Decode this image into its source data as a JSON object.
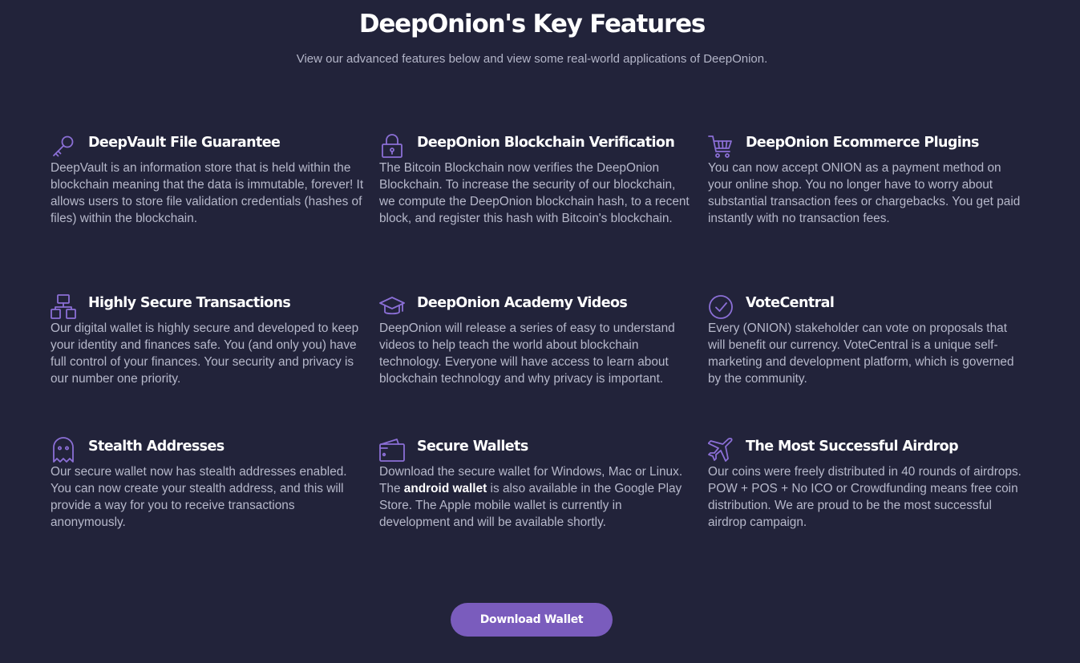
{
  "header": {
    "title": "DeepOnion's Key Features",
    "subtitle": "View our advanced features below and view some real-world applications of DeepOnion."
  },
  "colors": {
    "background": "#22233a",
    "accent": "#7a5cbd",
    "icon": "#8b6fd6",
    "heading": "#ffffff",
    "text": "#b6b8ca"
  },
  "features": [
    {
      "icon": "key-icon",
      "title": "DeepVault File Guarantee",
      "description": "DeepVault is an information store that is held within the blockchain meaning that the data is immutable, forever! It allows users to store file validation credentials (hashes of files) within the blockchain."
    },
    {
      "icon": "padlock-icon",
      "title": "DeepOnion Blockchain Verification",
      "description": "The Bitcoin Blockchain now verifies the DeepOnion Blockchain. To increase the security of our blockchain, we compute the DeepOnion blockchain hash, to a recent block, and register this hash with Bitcoin's blockchain."
    },
    {
      "icon": "shopping-cart-icon",
      "title": "DeepOnion Ecommerce Plugins",
      "description": "You can now accept ONION as a payment method on your online shop. You no longer have to worry about substantial transaction fees or chargebacks. You get paid instantly with no transaction fees."
    },
    {
      "icon": "network-icon",
      "title": "Highly Secure Transactions",
      "description": "Our digital wallet is highly secure and developed to keep your identity and finances safe. You (and only you) have full control of your finances. Your security and privacy is our number one priority."
    },
    {
      "icon": "graduation-cap-icon",
      "title": "DeepOnion Academy Videos",
      "description": "DeepOnion will release a series of easy to understand videos to help teach the world about blockchain technology. Everyone will have access to learn about blockchain technology and why privacy is important."
    },
    {
      "icon": "check-circle-icon",
      "title": "VoteCentral",
      "description": "Every (ONION) stakeholder can vote on proposals that will benefit our currency. VoteCentral is a unique self-marketing and development platform, which is governed by the community."
    },
    {
      "icon": "ghost-icon",
      "title": "Stealth Addresses",
      "description": "Our secure wallet now has stealth addresses enabled. You can now create your stealth address, and this will provide a way for you to receive transactions anonymously."
    },
    {
      "icon": "wallet-icon",
      "title": "Secure Wallets",
      "description_before": "Download the secure wallet for Windows, Mac or Linux. The ",
      "description_bold": "android wallet",
      "description_after": " is also available in the Google Play Store. The Apple mobile wallet is currently in development and will be available shortly."
    },
    {
      "icon": "airplane-icon",
      "title": "The Most Successful Airdrop",
      "description": "Our coins were freely distributed in 40 rounds of airdrops. POW + POS + No ICO or Crowdfunding means free coin distribution. We are proud to be the most successful airdrop campaign."
    }
  ],
  "cta": {
    "download_label": "Download Wallet"
  }
}
